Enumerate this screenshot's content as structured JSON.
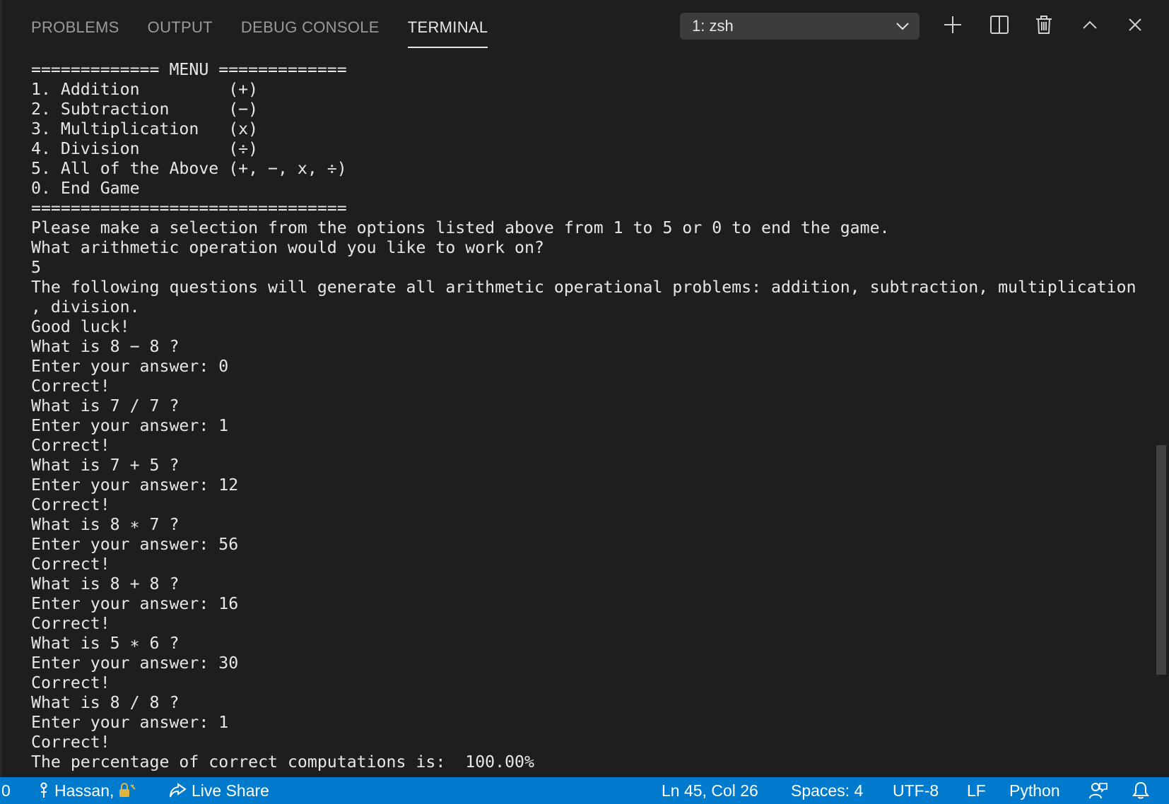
{
  "panel": {
    "tabs": [
      {
        "label": "PROBLEMS"
      },
      {
        "label": "OUTPUT"
      },
      {
        "label": "DEBUG CONSOLE"
      },
      {
        "label": "TERMINAL"
      }
    ],
    "active_tab": "TERMINAL",
    "terminal_select": {
      "value": "1: zsh"
    },
    "icons": [
      "plus-icon",
      "split-icon",
      "trash-icon",
      "chevron-up-icon",
      "close-icon"
    ]
  },
  "terminal": {
    "lines": [
      "============= MENU =============",
      "1. Addition         (+)",
      "2. Subtraction      (−)",
      "3. Multiplication   (x)",
      "4. Division         (÷)",
      "5. All of the Above (+, −, x, ÷)",
      "0. End Game",
      "================================",
      "Please make a selection from the options listed above from 1 to 5 or 0 to end the game.",
      "What arithmetic operation would you like to work on?",
      "5",
      "The following questions will generate all arithmetic operational problems: addition, subtraction, multiplication",
      ", division.",
      "Good luck!",
      "What is 8 − 8 ?",
      "Enter your answer: 0",
      "Correct!",
      "What is 7 / 7 ?",
      "Enter your answer: 1",
      "Correct!",
      "What is 7 + 5 ?",
      "Enter your answer: 12",
      "Correct!",
      "What is 8 ∗ 7 ?",
      "Enter your answer: 56",
      "Correct!",
      "What is 8 + 8 ?",
      "Enter your answer: 16",
      "Correct!",
      "What is 5 ∗ 6 ?",
      "Enter your answer: 30",
      "Correct!",
      "What is 8 / 8 ?",
      "Enter your answer: 1",
      "Correct!",
      "The percentage of correct computations is:  100.00%"
    ]
  },
  "statusbar": {
    "count": "0",
    "user": "Hassan,",
    "live_share": "Live Share",
    "position": "Ln 45, Col 26",
    "spaces": "Spaces: 4",
    "encoding": "UTF-8",
    "eol": "LF",
    "language": "Python",
    "background": "#007acc"
  },
  "colors": {
    "background": "#1e1e1e",
    "text": "#e7e7e7",
    "inactive_tab": "#9a9a9a",
    "statusbar": "#007acc"
  }
}
